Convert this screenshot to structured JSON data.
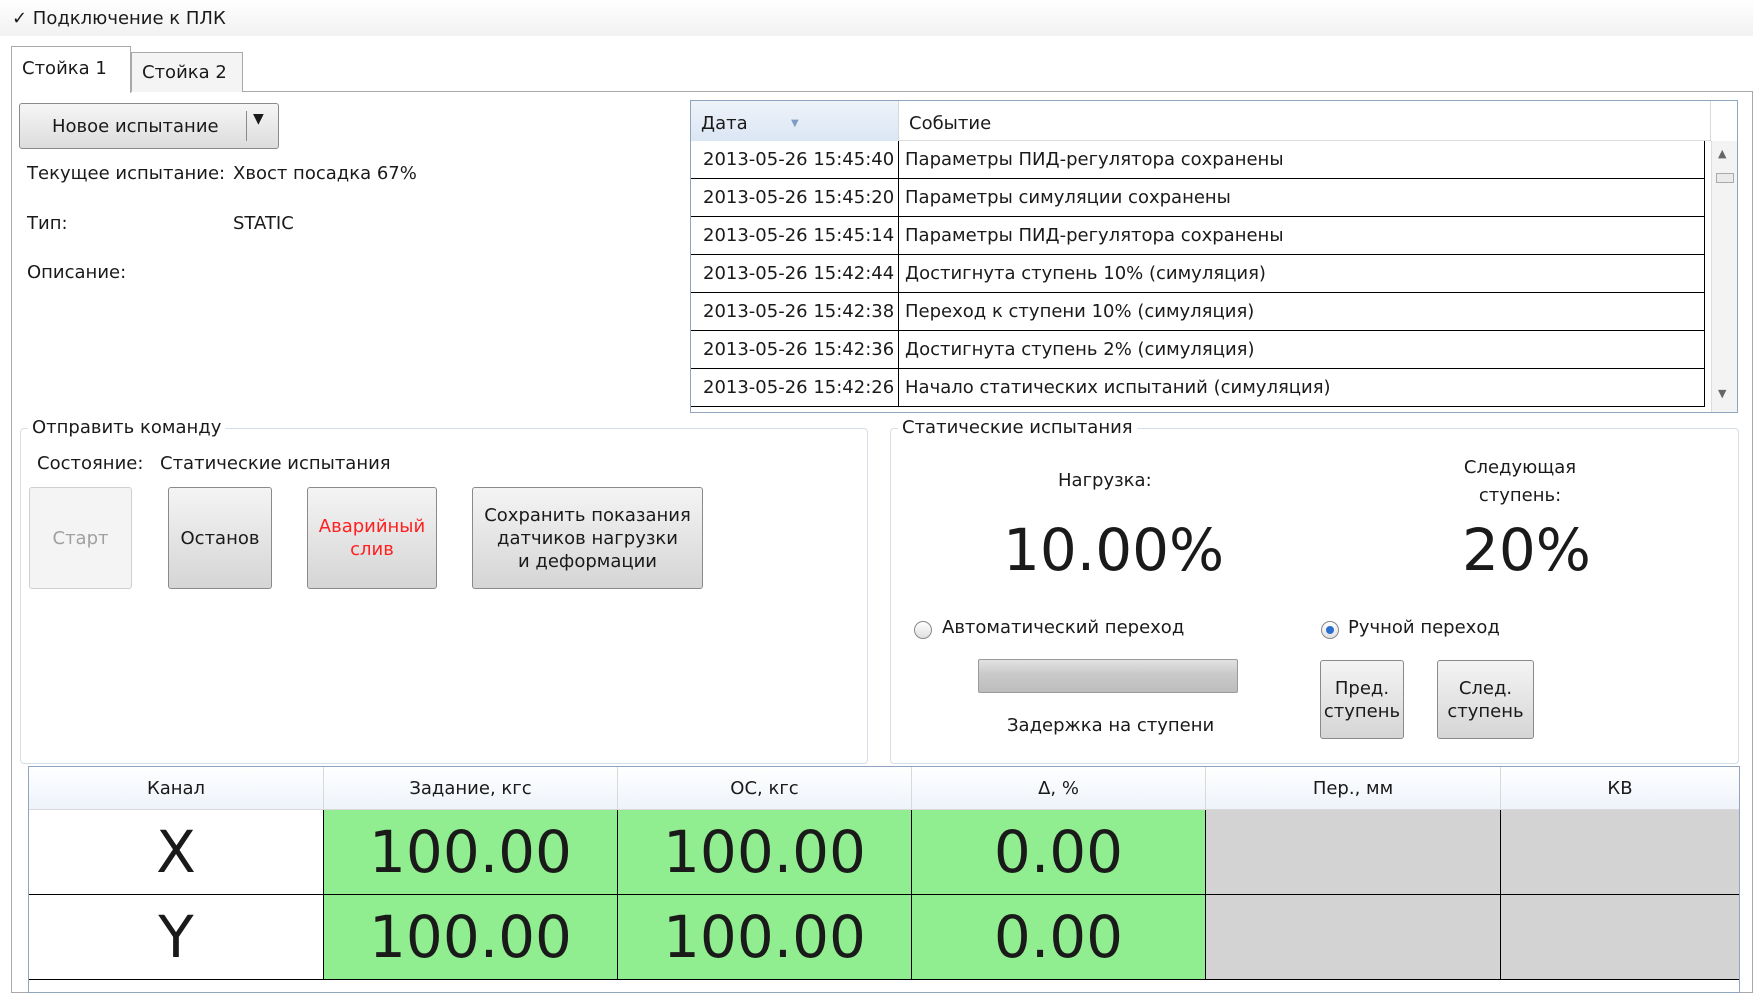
{
  "header": {
    "connection": "✓ Подключение к ПЛК"
  },
  "tabs": [
    "Стойка 1",
    "Стойка 2"
  ],
  "test": {
    "new_test_button": "Новое испытание",
    "current_label": "Текущее испытание:",
    "current_value": "Хвост посадка 67%",
    "type_label": "Тип:",
    "type_value": "STATIC",
    "description_label": "Описание:"
  },
  "events": {
    "columns": [
      "Дата",
      "Событие"
    ],
    "rows": [
      {
        "date": "2013-05-26 15:45:40",
        "event": "Параметры ПИД-регулятора сохранены"
      },
      {
        "date": "2013-05-26 15:45:20",
        "event": "Параметры симуляции сохранены"
      },
      {
        "date": "2013-05-26 15:45:14",
        "event": "Параметры ПИД-регулятора сохранены"
      },
      {
        "date": "2013-05-26 15:42:44",
        "event": "Достигнута ступень 10% (симуляция)"
      },
      {
        "date": "2013-05-26 15:42:38",
        "event": "Переход к ступени 10% (симуляция)"
      },
      {
        "date": "2013-05-26 15:42:36",
        "event": "Достигнута ступень 2% (симуляция)"
      },
      {
        "date": "2013-05-26 15:42:26",
        "event": "Начало статических испытаний (симуляция)"
      }
    ]
  },
  "command": {
    "title": "Отправить команду",
    "state_label": "Состояние:",
    "state_value": "Статические испытания",
    "start": "Старт",
    "stop": "Останов",
    "drain_line1": "Аварийный",
    "drain_line2": "слив",
    "save_line1": "Сохранить показания",
    "save_line2": "датчиков нагрузки",
    "save_line3": "и деформации"
  },
  "static_test": {
    "title": "Статические испытания",
    "load_label": "Нагрузка:",
    "load_value": "10.00%",
    "next_label_line1": "Следующая",
    "next_label_line2": "ступень:",
    "next_value": "20%",
    "auto_transition": "Автоматический переход",
    "manual_transition": "Ручной переход",
    "selected_mode": "manual",
    "delay_label": "Задержка на ступени",
    "prev_line1": "Пред.",
    "prev_line2": "ступень",
    "next_line1": "След.",
    "next_line2": "ступень"
  },
  "channels": {
    "columns": [
      "Канал",
      "Задание, кгс",
      "ОС, кгс",
      "Δ, %",
      "Пер., мм",
      "КВ"
    ],
    "rows": [
      {
        "channel": "X",
        "setpoint": "100.00",
        "feedback": "100.00",
        "delta": "0.00",
        "displacement": "",
        "kv": ""
      },
      {
        "channel": "Y",
        "setpoint": "100.00",
        "feedback": "100.00",
        "delta": "0.00",
        "displacement": "",
        "kv": ""
      }
    ]
  },
  "colors": {
    "ok": "#90ee90",
    "inactive": "#d3d3d3",
    "alarm": "#ff2020",
    "accent": "#2a6fcf"
  }
}
